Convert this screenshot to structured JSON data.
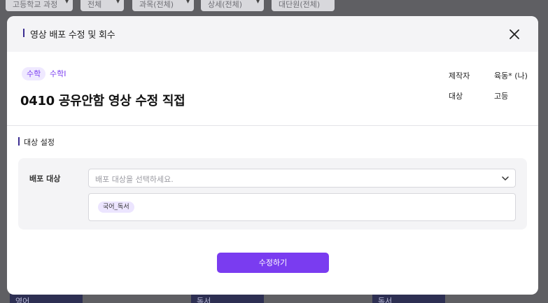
{
  "background": {
    "filters": [
      {
        "label": "고등학교 과정"
      },
      {
        "label": "전체"
      },
      {
        "label": "과목(전체)"
      },
      {
        "label": "상세(전체)"
      },
      {
        "label": "대단원(전체)"
      }
    ],
    "tiles": [
      "영어",
      "독서",
      "독서"
    ]
  },
  "modal": {
    "title": "영상 배포 수정 및 회수",
    "close_icon": "close-icon",
    "subject_tag": "수학",
    "subject_detail": "수학Ⅰ",
    "video_title": "0410 공유안함 영상 수정 직접",
    "meta": {
      "producer_label": "제작자",
      "producer_value": "육동* (나)",
      "target_label": "대상",
      "target_value": "고등"
    },
    "section_title": "대상 설정",
    "distribution": {
      "label": "배포 대상",
      "placeholder": "배포 대상을 선택하세요.",
      "selected_chips": [
        "국어_독서"
      ]
    },
    "submit_label": "수정하기"
  },
  "colors": {
    "accent": "#7a3cf0",
    "title_bar": "#3b2d91",
    "chip_bg": "#ece5ff"
  }
}
